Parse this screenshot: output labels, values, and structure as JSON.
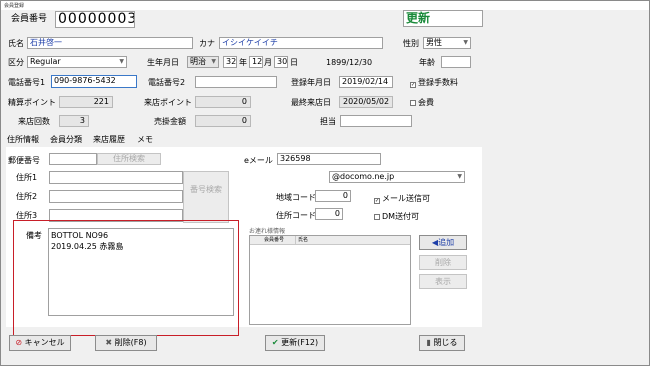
{
  "window": {
    "title": "会員登録"
  },
  "member": {
    "no_label": "会員番号",
    "no_value": "00000003",
    "mode_label": "更新",
    "name_label": "氏名",
    "name_value": "石井啓一",
    "kana_label": "カナ",
    "kana_value": "イシイケイイチ",
    "gender_label": "性別",
    "gender_value": "男性",
    "category_label": "区分",
    "category_value": "Regular",
    "birth_label": "生年月日",
    "era_value": "明治",
    "year_value": "32",
    "year_unit": "年",
    "month_value": "12",
    "month_unit": "月",
    "day_value": "30",
    "day_unit": "日",
    "birth_display": "1899/12/30",
    "age_label": "年齢",
    "age_value": "",
    "tel1_label": "電話番号1",
    "tel1_value": "090-9876-5432",
    "tel2_label": "電話番号2",
    "tel2_value": "",
    "reg_date_label": "登録年月日",
    "reg_date_value": "2019/02/14",
    "reg_fee_label": "登録手数料",
    "points_label": "精算ポイント",
    "points_value": "221",
    "visit_points_label": "来店ポイント",
    "visit_points_value": "0",
    "last_visit_label": "最終来店日",
    "last_visit_value": "2020/05/02",
    "membership_label": "会費",
    "visits_label": "来店回数",
    "visits_value": "3",
    "credit_label": "売掛金額",
    "credit_value": "0",
    "staff_label": "担当",
    "staff_value": ""
  },
  "tabs": [
    "住所情報",
    "会員分類",
    "来店履歴",
    "メモ"
  ],
  "address": {
    "zip_label": "郵便番号",
    "zip_value": "",
    "zip_search_label": "住所検索",
    "addr1_label": "住所1",
    "addr2_label": "住所2",
    "addr3_label": "住所3",
    "reverse_search_label": "番号検索",
    "email_label": "eメール",
    "email_value": "326598",
    "email_domain_value": "@docomo.ne.jp",
    "region_code_label": "地域コード",
    "region_code_value": "0",
    "addr_code_label": "住所コード",
    "addr_code_value": "0",
    "mail_ok_label": "メール送信可",
    "dm_ok_label": "DM送付可"
  },
  "notes": {
    "label": "備考",
    "line1": "BOTTOL NO96",
    "line2": "2019.04.25 赤霧島"
  },
  "companions": {
    "title": "お連れ様情報",
    "col1": "会員番号",
    "col2": "氏名",
    "add_label": "◀追加",
    "delete_label": "削除",
    "show_label": "表示"
  },
  "footer": {
    "cancel_label": "キャンセル",
    "delete_label": "削除(F8)",
    "update_label": "更新(F12)",
    "close_label": "閉じる"
  },
  "colors": {
    "highlight_border": "#c81e28",
    "mode_text": "#1a8a3a",
    "name_text": "#1d3ea8"
  }
}
